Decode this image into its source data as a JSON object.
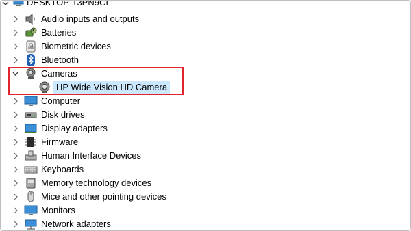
{
  "tree": {
    "root": {
      "label": "DESKTOP-13PN9CI",
      "icon": "computer-icon"
    },
    "categories": [
      {
        "label": "Audio inputs and outputs",
        "icon": "speaker-icon",
        "expanded": false
      },
      {
        "label": "Batteries",
        "icon": "battery-icon",
        "expanded": false
      },
      {
        "label": "Biometric devices",
        "icon": "fingerprint-icon",
        "expanded": false
      },
      {
        "label": "Bluetooth",
        "icon": "bluetooth-icon",
        "expanded": false
      },
      {
        "label": "Cameras",
        "icon": "camera-icon",
        "expanded": true,
        "children": [
          {
            "label": "HP Wide Vision HD Camera",
            "icon": "webcam-icon",
            "selected": true
          }
        ]
      },
      {
        "label": "Computer",
        "icon": "monitor-icon",
        "expanded": false
      },
      {
        "label": "Disk drives",
        "icon": "disk-drive-icon",
        "expanded": false
      },
      {
        "label": "Display adapters",
        "icon": "display-adapter-icon",
        "expanded": false
      },
      {
        "label": "Firmware",
        "icon": "firmware-icon",
        "expanded": false
      },
      {
        "label": "Human Interface Devices",
        "icon": "hid-icon",
        "expanded": false
      },
      {
        "label": "Keyboards",
        "icon": "keyboard-icon",
        "expanded": false
      },
      {
        "label": "Memory technology devices",
        "icon": "memory-card-icon",
        "expanded": false
      },
      {
        "label": "Mice and other pointing devices",
        "icon": "mouse-icon",
        "expanded": false
      },
      {
        "label": "Monitors",
        "icon": "monitor-icon",
        "expanded": false
      },
      {
        "label": "Network adapters",
        "icon": "network-adapter-icon",
        "expanded": false
      }
    ]
  },
  "colors": {
    "selection": "#cce8ff",
    "highlight_border": "#e0252d",
    "chevron": "#6d6d6d"
  }
}
